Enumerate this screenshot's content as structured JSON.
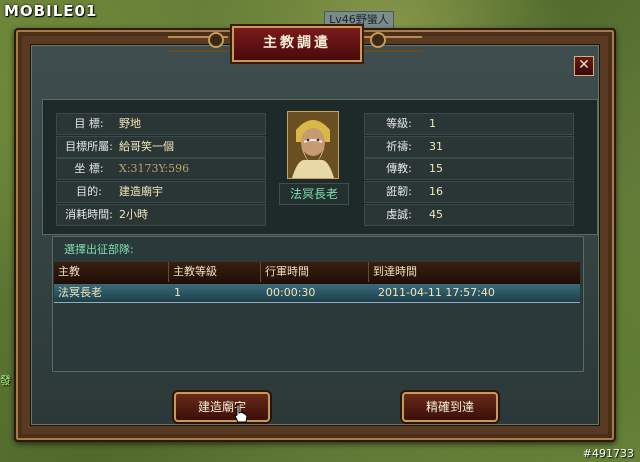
{
  "watermark": {
    "logo": "MOBILE01",
    "image_id": "#491733"
  },
  "map": {
    "top_label": "Lv46野蠻人",
    "side_text": "發"
  },
  "dialog": {
    "title": "主教調遣",
    "close_label": "✕"
  },
  "target": {
    "rows": [
      {
        "label": "目 標:",
        "value": "野地"
      },
      {
        "label": "目標所屬:",
        "value": "給哥笑一個"
      },
      {
        "label": "坐 標:",
        "value": "X:3173Y:596"
      },
      {
        "label": "目的:",
        "value": "建造廟宇"
      },
      {
        "label": "消耗時間:",
        "value": "2小時"
      }
    ]
  },
  "bishop": {
    "name": "法冥長老",
    "portrait_icon": "elder-bishop-portrait",
    "stats": [
      {
        "label": "等級:",
        "value": "1"
      },
      {
        "label": "祈禱:",
        "value": "31"
      },
      {
        "label": "傳教:",
        "value": "15"
      },
      {
        "label": "誑韌:",
        "value": "16"
      },
      {
        "label": "虔誠:",
        "value": "45"
      }
    ]
  },
  "troops": {
    "title": "選擇出征部隊:",
    "columns": [
      "主教",
      "主教等級",
      "行軍時間",
      "到達時間"
    ],
    "rows": [
      [
        "法冥長老",
        "1",
        "00:00:30",
        "2011-04-11 17:57:40"
      ]
    ]
  },
  "buttons": {
    "build": "建造廟宇",
    "precise": "精確到達"
  },
  "colors": {
    "frame": "#5a3a22",
    "panel": "#2a3636",
    "accent_text": "#7fe0b0",
    "value_text": "#f2e6b8"
  }
}
